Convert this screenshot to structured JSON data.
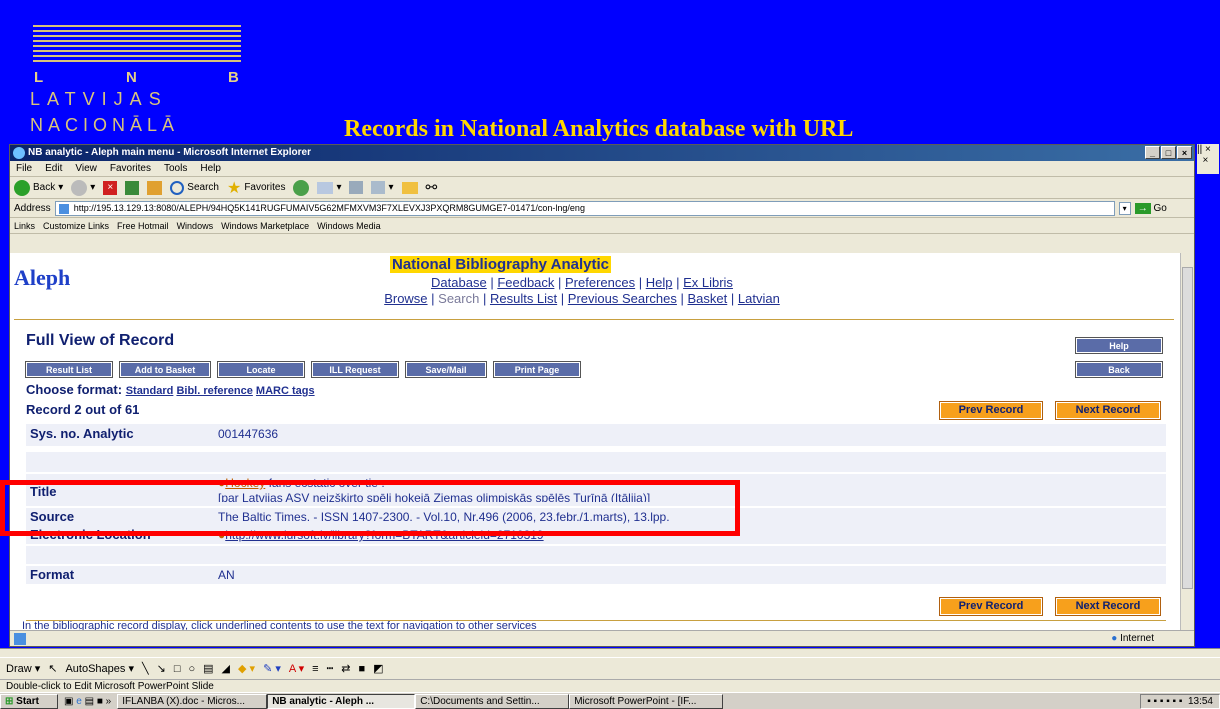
{
  "logo": {
    "letter1": "L",
    "letter2": "N",
    "letter3": "B",
    "word1": "LATVIJAS",
    "word2": "NACIONĀLĀ"
  },
  "slide_title": "Records in National Analytics database with URL",
  "ie": {
    "title": "NB analytic - Aleph main menu - Microsoft Internet Explorer",
    "menu": [
      "File",
      "Edit",
      "View",
      "Favorites",
      "Tools",
      "Help"
    ],
    "toolbar": {
      "back": "Back",
      "search": "Search",
      "favorites": "Favorites"
    },
    "address_label": "Address",
    "url": "http://195.13.129.13:8080/ALEPH/94HQ5K141RUGFUMAIV5G62MFMXVM3F7XLEVXJ3PXQRM8GUMGE7-01471/con-lng/eng",
    "go": "Go",
    "links_label": "Links",
    "links": [
      "Customize Links",
      "Free Hotmail",
      "Windows",
      "Windows Marketplace",
      "Windows Media"
    ],
    "status_zone": "Internet"
  },
  "aleph": {
    "logo": "Aleph",
    "title": "National Bibliography Analytic",
    "nav1": [
      "Database",
      "Feedback",
      "Preferences",
      "Help",
      "Ex Libris"
    ],
    "nav2": [
      "Browse",
      "Search",
      "Results List",
      "Previous Searches",
      "Basket",
      "Latvian"
    ]
  },
  "record": {
    "heading": "Full View of Record",
    "buttons": [
      "Result List",
      "Add to Basket",
      "Locate",
      "ILL Request",
      "Save/Mail",
      "Print Page"
    ],
    "help": "Help",
    "back": "Back",
    "choose_format_label": "Choose format:",
    "formats": [
      "Standard",
      "Bibl. reference",
      "MARC tags"
    ],
    "counter": "Record 2 out of 61",
    "prev": "Prev Record",
    "next": "Next Record",
    "sysno_label": "Sys. no. Analytic",
    "sysno": "001447636",
    "title_label": "Title",
    "title_link": "Hockey",
    "title_rest": " fans ecstatic over tie :",
    "title_line2": "[par Latvijas ASV neizšķirto spēli hokejā Ziemas olimpiskās spēlēs Turīnā (Itālija)]",
    "source_label": "Source",
    "source": "The Baltic Times. - ISSN 1407-2300. - Vol.10, Nr.496 (2006, 23.febr./1.marts), 13.lpp.",
    "eloc_label": "Electronic Location",
    "eloc": "http://www.lursoft.lv/library?form=BTART&articleid=2710319",
    "format_label": "Format",
    "format": "AN",
    "help_text": "In the bibliographic record display, click underlined contents to use the text for navigation to other services"
  },
  "ppt": {
    "draw": "Draw",
    "autoshapes": "AutoShapes",
    "status": "Double-click to Edit Microsoft PowerPoint Slide"
  },
  "taskbar": {
    "start": "Start",
    "items": [
      "IFLANBA (X).doc - Micros...",
      "NB analytic - Aleph ...",
      "C:\\Documents and Settin...",
      "Microsoft PowerPoint - [IF..."
    ],
    "clock": "13:54"
  }
}
